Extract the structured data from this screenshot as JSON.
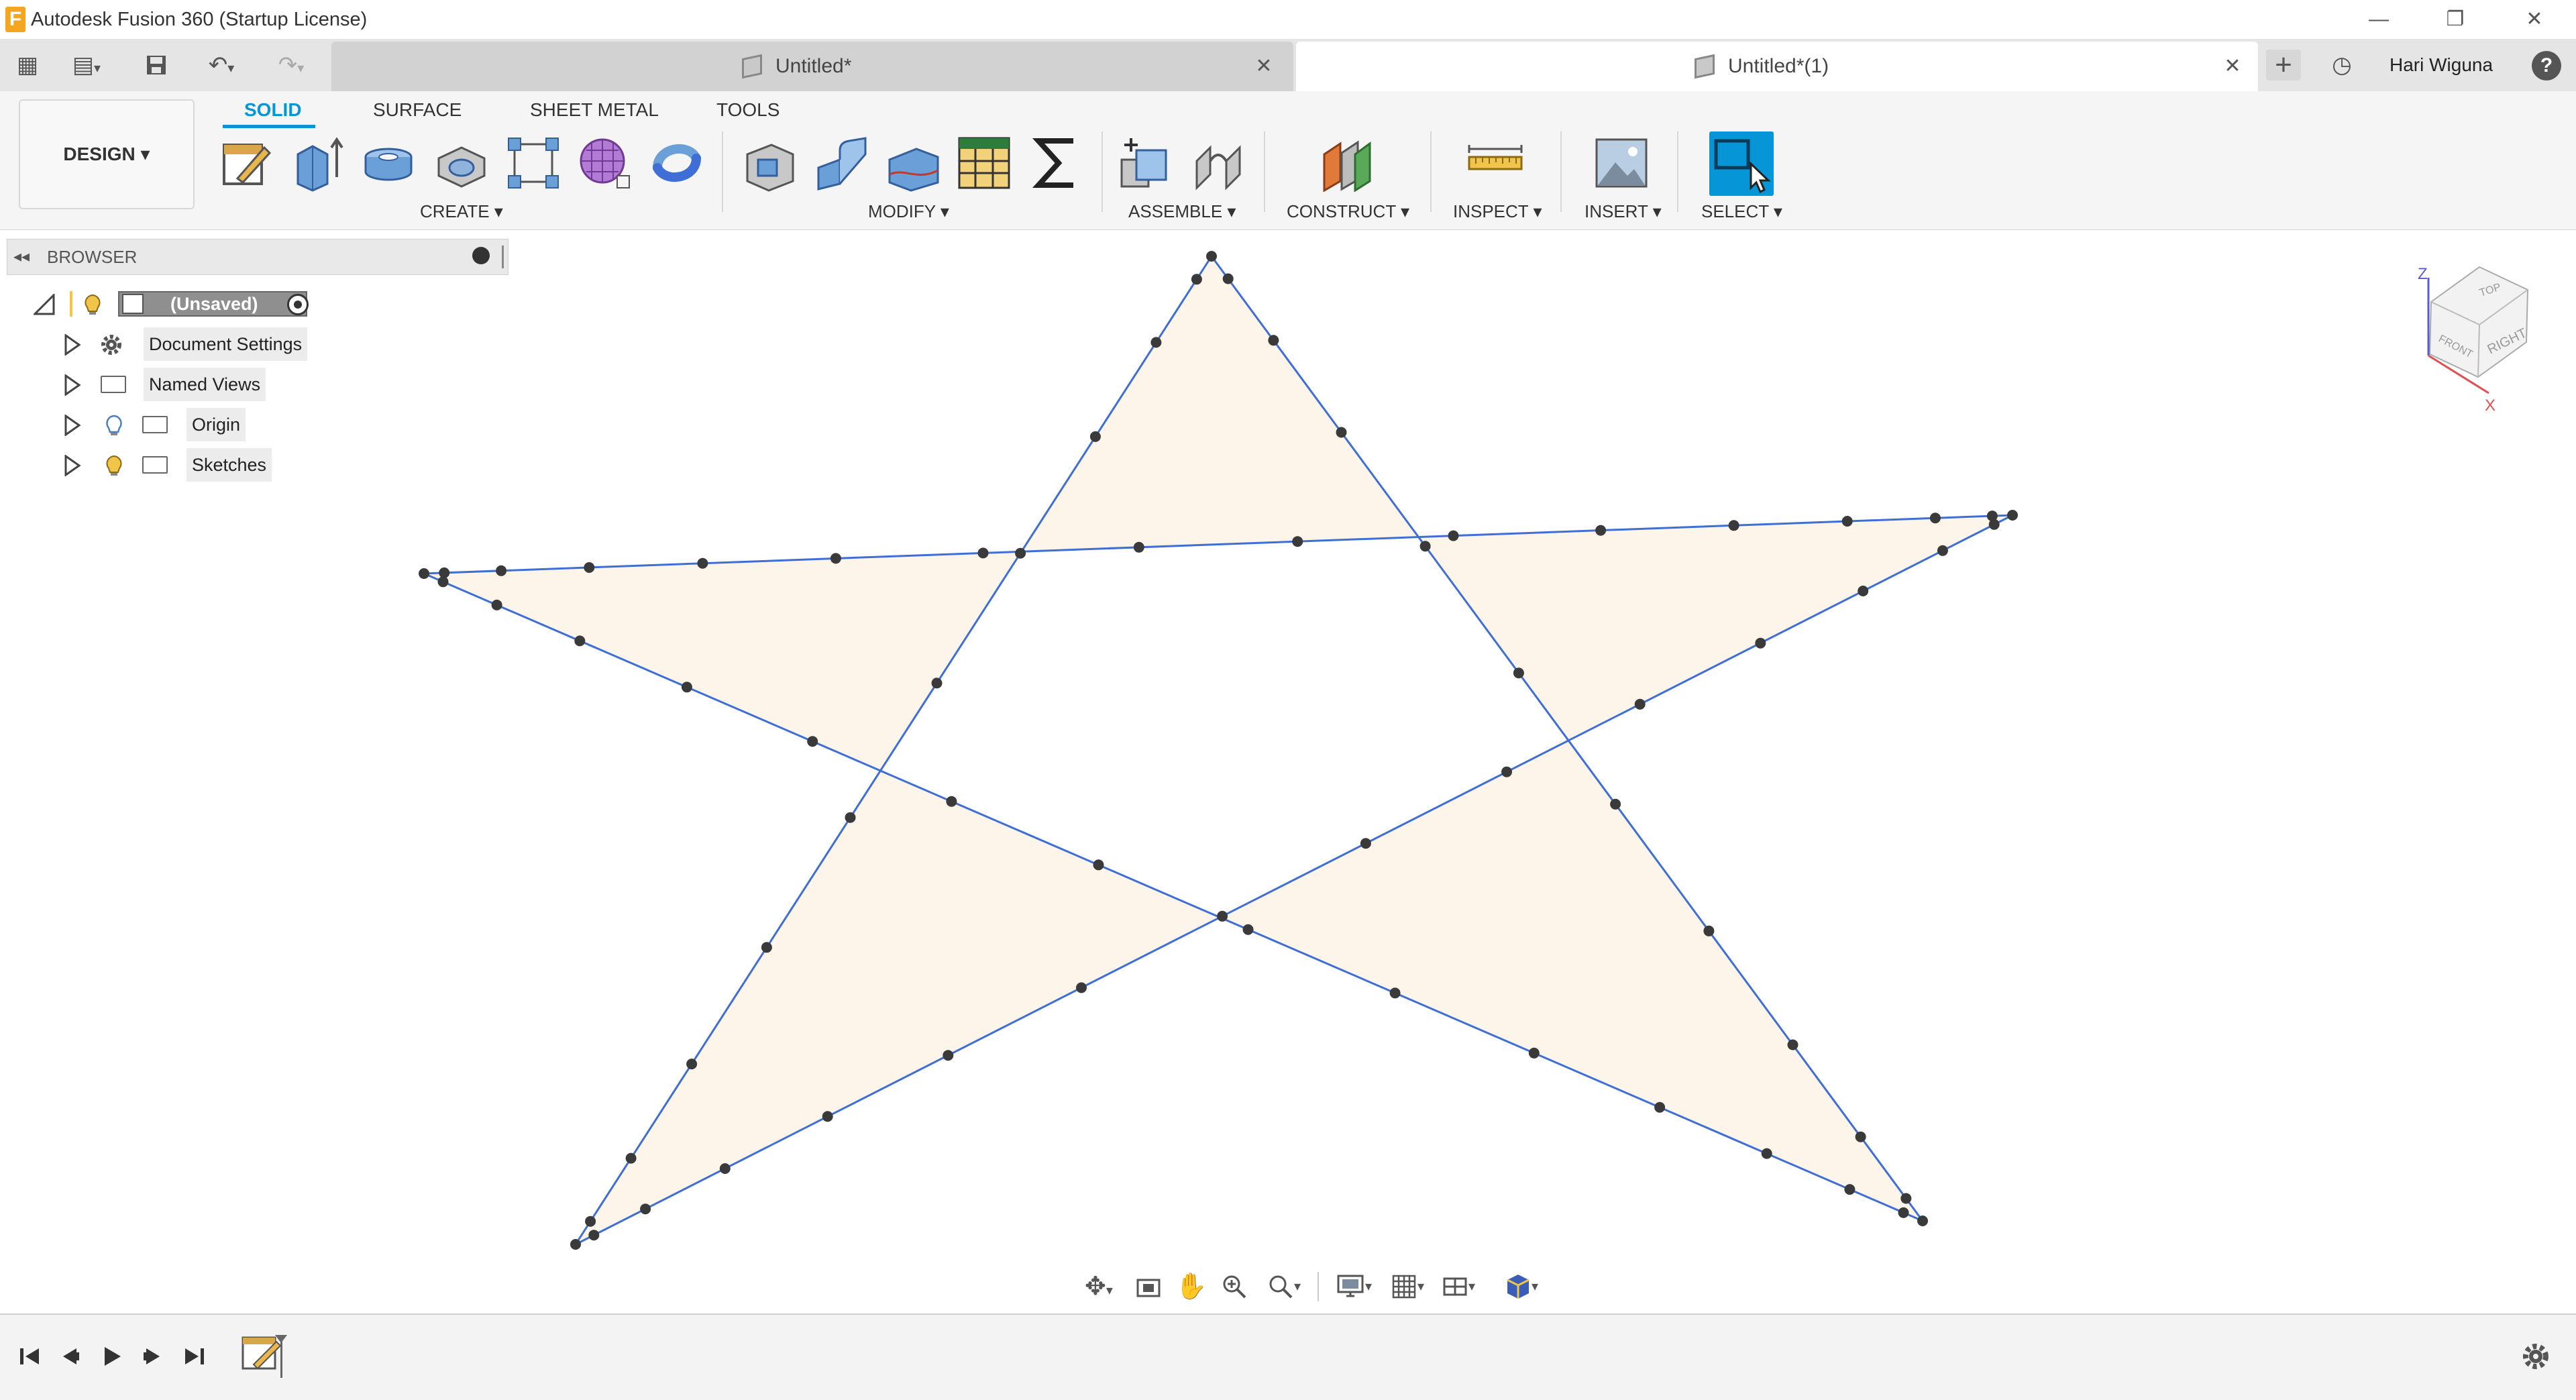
{
  "window": {
    "title": "Autodesk Fusion 360 (Startup License)",
    "minimize": "—",
    "restore": "❐",
    "close": "✕"
  },
  "tabs": [
    {
      "label": "Untitled*",
      "active": false
    },
    {
      "label": "Untitled*(1)",
      "active": true
    }
  ],
  "tab_close": "✕",
  "user": {
    "name": "Hari Wiguna"
  },
  "quick_access": {
    "grid": "▦",
    "file": "▤",
    "save": "💾",
    "undo": "↶",
    "redo": "↷",
    "add": "+",
    "history": "◷",
    "help": "?"
  },
  "toolbar": {
    "design_label": "DESIGN ▾",
    "workspace_tabs": [
      "SOLID",
      "SURFACE",
      "SHEET METAL",
      "TOOLS"
    ],
    "groups": {
      "create": "CREATE ▾",
      "modify": "MODIFY ▾",
      "assemble": "ASSEMBLE ▾",
      "construct": "CONSTRUCT ▾",
      "inspect": "INSPECT ▾",
      "insert": "INSERT ▾",
      "select": "SELECT ▾"
    }
  },
  "browser": {
    "title": "BROWSER",
    "root": "(Unsaved)",
    "items": [
      "Document Settings",
      "Named Views",
      "Origin",
      "Sketches"
    ]
  },
  "viewcube": {
    "top": "TOP",
    "front": "FRONT",
    "right": "RIGHT",
    "axis_z": "Z",
    "axis_x": "X"
  },
  "accent_color": "#0696d7",
  "sketch_profile_fill": "#fdf4ea",
  "sketch_line_color": "#3f6fd6"
}
